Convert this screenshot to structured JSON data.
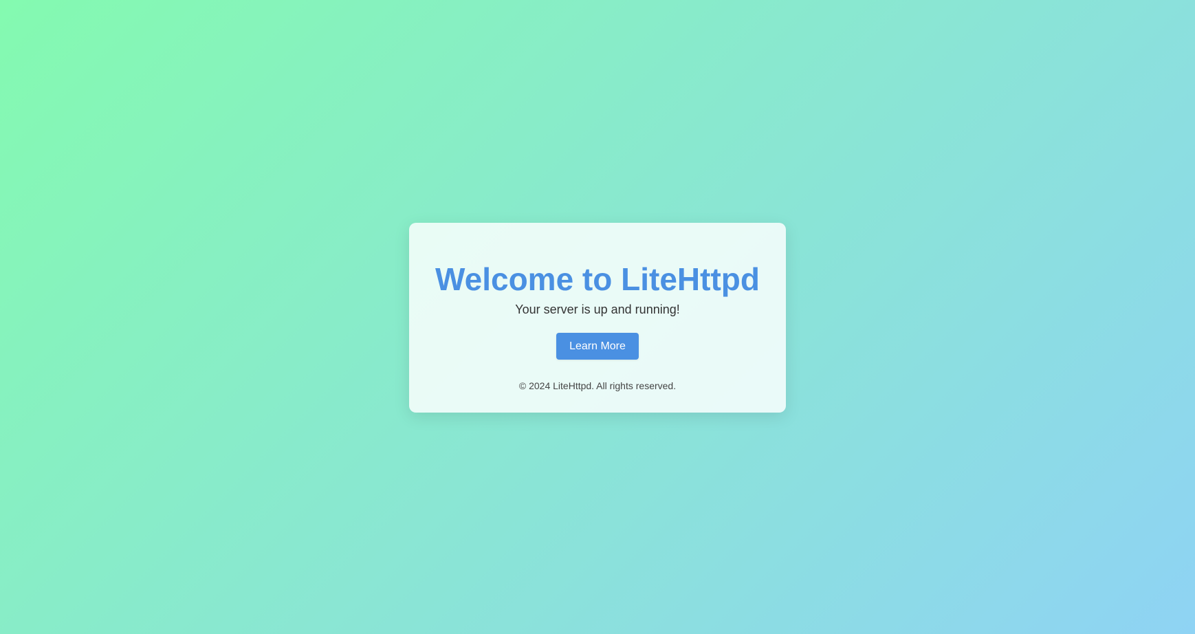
{
  "card": {
    "title": "Welcome to LiteHttpd",
    "subtitle": "Your server is up and running!",
    "button_label": "Learn More",
    "footer": "© 2024 LiteHttpd. All rights reserved."
  },
  "colors": {
    "accent": "#4a90e2",
    "gradient_start": "#84fab0",
    "gradient_end": "#8fd3f4"
  }
}
